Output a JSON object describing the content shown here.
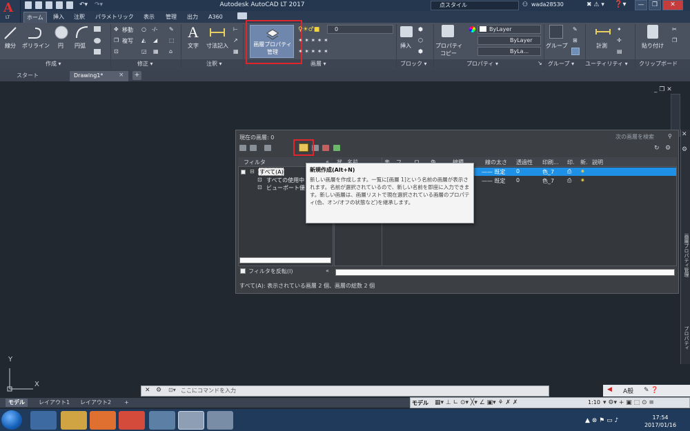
{
  "app": {
    "title": "Autodesk AutoCAD LT 2017",
    "logo": "A",
    "logo_sub": "LT"
  },
  "titlebar": {
    "search": "点スタイル",
    "user": "wada28530"
  },
  "menu_tabs": [
    "ホーム",
    "挿入",
    "注釈",
    "パラメトリック",
    "表示",
    "管理",
    "出力",
    "A360"
  ],
  "ribbon": {
    "draw": {
      "line": "線分",
      "polyline": "ポリライン",
      "circle": "円",
      "arc": "円弧",
      "title": "作成 ▾"
    },
    "modify": {
      "move": "移動",
      "copy": "複写",
      "title": "修正 ▾"
    },
    "annotation": {
      "text": "文字",
      "dimension": "寸法記入",
      "title": "注釈 ▾"
    },
    "layer": {
      "manager": "画層プロパティ\n管理",
      "manager1": "画層プロパティ",
      "manager2": "管理",
      "current": "0",
      "title": "画層 ▾"
    },
    "block": {
      "insert": "挿入",
      "title": "ブロック ▾"
    },
    "properties": {
      "match": "プロパティ",
      "match2": "コピー",
      "color": "ByLayer",
      "linetype": "ByLayer",
      "lineweight": "ByLa...",
      "title": "プロパティ ▾"
    },
    "groups": {
      "group": "グループ",
      "title": "グループ ▾"
    },
    "utilities": {
      "measure": "計測",
      "title": "ユーティリティ ▾"
    },
    "clipboard": {
      "paste": "貼り付け",
      "title": "クリップボード"
    }
  },
  "doc_tabs": [
    "スタート",
    "Drawing1*"
  ],
  "palette": {
    "current_layer": "現在の画層: 0",
    "search_placeholder": "次の画層を検索",
    "filter_header": "フィルタ",
    "columns": [
      "状",
      "名前",
      "表",
      "フ",
      "ロ",
      "色",
      "線種",
      "線の太さ",
      "透過性",
      "印刷...",
      "印.",
      "新.",
      "説明"
    ],
    "filter_tree": [
      "すべて(A)",
      "すべての使用中",
      "ビューポート優"
    ],
    "rows": [
      {
        "lineweight": "—— 既定",
        "transparency": "0",
        "plotstyle": "色_7"
      },
      {
        "lineweight": "—— 既定",
        "transparency": "0",
        "plotstyle": "色_7"
      }
    ],
    "invert_filter": "フィルタを反転(I)",
    "status": "すべて(A): 表示されている画層 2 個、画層の総数 2 個",
    "side_label": "画層プロパティ管理",
    "side_label2": "プロパティ"
  },
  "tooltip": {
    "title": "新規作成(Alt+N)",
    "body": "新しい画層を作成します。一覧に[画層 1]という名前の画層が表示されます。名前が選択されているので、新しい名前を即座に入力できます。新しい画層は、画層リストで現在選択されている画層のプロパティ(色、オン/オフの状態など)を継承します。"
  },
  "ucs": {
    "x": "X",
    "y": "Y"
  },
  "command": {
    "placeholder": "ここにコマンドを入力"
  },
  "layout_tabs": [
    "モデル",
    "レイアウト1",
    "レイアウト2"
  ],
  "statusbar": {
    "model": "モデル",
    "scale": "1:10"
  },
  "mini_toolbar": {
    "label": "A般"
  },
  "taskbar": {
    "time": "17:54",
    "date": "2017/01/16"
  }
}
